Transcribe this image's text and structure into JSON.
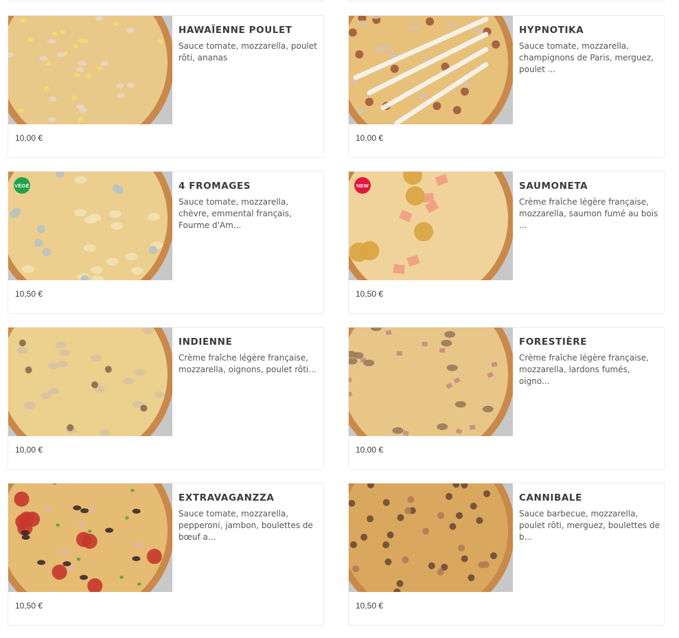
{
  "colors": {
    "veg_badge": "#22a04a",
    "new_badge": "#e3173e",
    "card_border": "#ececec"
  },
  "products": [
    {
      "name": "HAWAÏENNE POULET",
      "description": "Sauce tomate, mozzarella, poulet rôti, ananas",
      "price": "10,00 €",
      "badge": "",
      "badge_type": "",
      "image": "hawaiian-pizza-image"
    },
    {
      "name": "HYPNOTIKA",
      "description": "Sauce tomate, mozzarella, champignons de Paris, merguez, poulet ...",
      "price": "10,00 €",
      "badge": "",
      "badge_type": "",
      "image": "hypnotika-pizza-image"
    },
    {
      "name": "4 FROMAGES",
      "description": "Sauce tomate, mozzarella, chèvre, emmental français, Fourme d'Am...",
      "price": "10,50 €",
      "badge": "VÉGÉ",
      "badge_type": "veg",
      "image": "four-cheese-pizza-image"
    },
    {
      "name": "SAUMONETA",
      "description": "Crème fraîche légère française, mozzarella, saumon fumé au bois ...",
      "price": "10,50 €",
      "badge": "NEW",
      "badge_type": "new",
      "image": "salmon-pizza-image"
    },
    {
      "name": "INDIENNE",
      "description": "Crème fraîche légère française, mozzarella, oignons, poulet rôti...",
      "price": "10,00 €",
      "badge": "",
      "badge_type": "",
      "image": "indian-pizza-image"
    },
    {
      "name": "FORESTIÈRE",
      "description": "Crème fraîche légère française, mozzarella, lardons fumés, oigno...",
      "price": "10,00 €",
      "badge": "",
      "badge_type": "",
      "image": "forest-pizza-image"
    },
    {
      "name": "EXTRAVAGANZZA",
      "description": "Sauce tomate, mozzarella, pepperoni, jambon, boulettes de bœuf a...",
      "price": "10,50 €",
      "badge": "",
      "badge_type": "",
      "image": "extravaganzza-pizza-image"
    },
    {
      "name": "CANNIBALE",
      "description": "Sauce barbecue, mozzarella, poulet rôti, merguez, boulettes de b...",
      "price": "10,50 €",
      "badge": "",
      "badge_type": "",
      "image": "cannibale-pizza-image"
    }
  ]
}
